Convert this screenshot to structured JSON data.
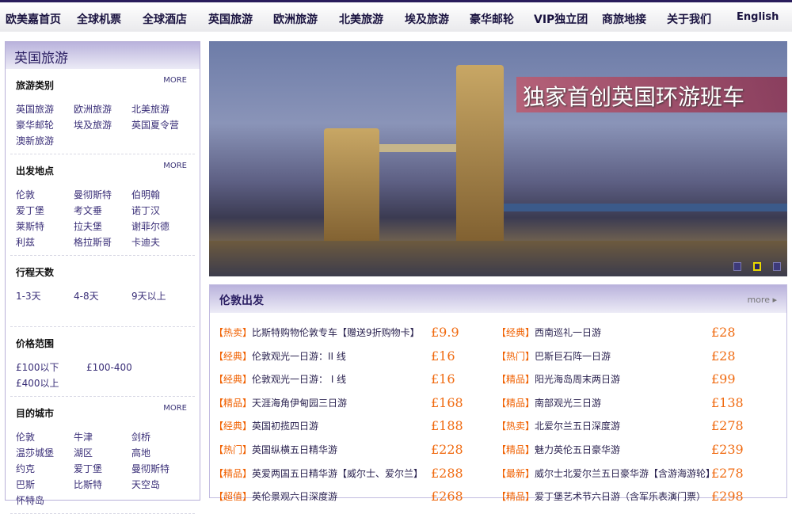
{
  "nav": [
    "欧美嘉首页",
    "全球机票",
    "全球酒店",
    "英国旅游",
    "欧洲旅游",
    "北美旅游",
    "埃及旅游",
    "豪华邮轮",
    "VIP独立团",
    "商旅地接",
    "关于我们",
    "English"
  ],
  "sidebar": {
    "title": "英国旅游",
    "more": "MORE",
    "groups": [
      {
        "title": "旅游类别",
        "more": true,
        "items": [
          "英国旅游",
          "欧洲旅游",
          "北美旅游",
          "豪华邮轮",
          "埃及旅游",
          "英国夏令营",
          "澳新旅游"
        ]
      },
      {
        "title": "出发地点",
        "more": true,
        "items": [
          "伦敦",
          "曼彻斯特",
          "伯明翰",
          "爱丁堡",
          "考文垂",
          "诺丁汉",
          "莱斯特",
          "拉夫堡",
          "谢菲尔德",
          "利兹",
          "格拉斯哥",
          "卡迪夫"
        ]
      },
      {
        "title": "行程天数",
        "more": false,
        "items": [
          "1-3天",
          "4-8天",
          "9天以上"
        ]
      },
      {
        "title": "价格范围",
        "more": false,
        "items": [
          "£100以下",
          "£100-400",
          "£400以上"
        ]
      },
      {
        "title": "目的城市",
        "more": true,
        "items": [
          "伦敦",
          "牛津",
          "剑桥",
          "温莎城堡",
          "湖区",
          "高地",
          "约克",
          "爱丁堡",
          "曼彻斯特",
          "巴斯",
          "比斯特",
          "天空岛",
          "怀特岛"
        ]
      }
    ]
  },
  "banner": {
    "caption": "独家首创英国环游班车",
    "slides": 3,
    "active_slide": 2
  },
  "london": {
    "title": "伦敦出发",
    "more": "more ▸",
    "left": [
      {
        "tag": "【热卖】",
        "name": "比斯特购物伦敦专车【赠送9折购物卡】",
        "price": "£9.9"
      },
      {
        "tag": "【经典】",
        "name": "伦敦观光一日游：II 线",
        "price": "£16"
      },
      {
        "tag": "【经典】",
        "name": "伦敦观光一日游： I 线",
        "price": "£16"
      },
      {
        "tag": "【精品】",
        "name": "天涯海角伊甸园三日游",
        "price": "£168"
      },
      {
        "tag": "【经典】",
        "name": "英国初揽四日游",
        "price": "£188"
      },
      {
        "tag": "【热门】",
        "name": "英国纵横五日精华游",
        "price": "£228"
      },
      {
        "tag": "【精品】",
        "name": "英爱两国五日精华游【威尔士、爱尔兰】",
        "price": "£288"
      },
      {
        "tag": "【超值】",
        "name": "英伦景观六日深度游",
        "price": "£268"
      }
    ],
    "right": [
      {
        "tag": "【经典】",
        "name": "西南巡礼一日游",
        "price": "£28"
      },
      {
        "tag": "【热门】",
        "name": "巴斯巨石阵一日游",
        "price": "£28"
      },
      {
        "tag": "【精品】",
        "name": "阳光海岛周末两日游",
        "price": "£99"
      },
      {
        "tag": "【精品】",
        "name": "南部观光三日游",
        "price": "£138"
      },
      {
        "tag": "【热卖】",
        "name": "北爱尔兰五日深度游",
        "price": "£278"
      },
      {
        "tag": "【精品】",
        "name": "魅力英伦五日豪华游",
        "price": "£239"
      },
      {
        "tag": "【最新】",
        "name": "威尔士北爱尔兰五日豪华游【含游海游轮】",
        "price": "£278"
      },
      {
        "tag": "【精品】",
        "name": "爱丁堡艺术节六日游（含军乐表演门票）",
        "price": "£298"
      }
    ]
  }
}
